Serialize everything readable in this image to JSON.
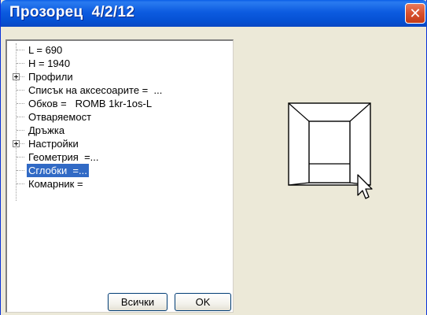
{
  "window": {
    "title": "Прозорец  4/2/12",
    "close_glyph": "✕"
  },
  "tree": {
    "items": [
      {
        "label": "L = 690",
        "expandable": false
      },
      {
        "label": "H = 1940",
        "expandable": false
      },
      {
        "label": "Профили",
        "expandable": true
      },
      {
        "label": "Списък на аксесоарите =  ...",
        "expandable": false
      },
      {
        "label": "Обков =   ROMB 1kr-1os-L",
        "expandable": false
      },
      {
        "label": "Отваряемост",
        "expandable": false
      },
      {
        "label": "Дръжка",
        "expandable": false
      },
      {
        "label": "Настройки",
        "expandable": true
      },
      {
        "label": "Геометрия  =...",
        "expandable": false
      },
      {
        "label": "Сглобки  =...",
        "expandable": false,
        "selected": true
      },
      {
        "label": "Комарник =",
        "expandable": false
      }
    ]
  },
  "buttons": {
    "all_label": "Всички",
    "ok_label": "OK"
  },
  "icons": {
    "close": "close-icon",
    "expand": "plus-expander-icon",
    "cursor": "mouse-pointer-icon"
  },
  "colors": {
    "title_bar": "#0a5ee8",
    "selection": "#316ac5",
    "close_button": "#d8512e",
    "dialog_background": "#ece9d8"
  }
}
